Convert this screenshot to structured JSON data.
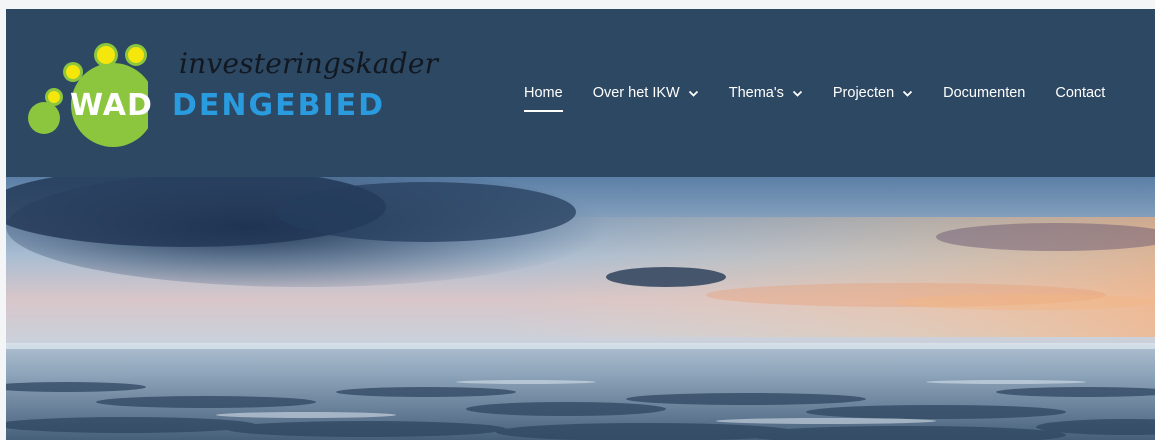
{
  "logo": {
    "line1": "investeringskader",
    "wad": "WAD",
    "rest": "DENGEBIED",
    "colors": {
      "green": "#8cc63f",
      "yellow": "#f5e60c",
      "blue": "#2b9be0"
    }
  },
  "nav": {
    "items": [
      {
        "label": "Home",
        "active": true,
        "has_dropdown": false
      },
      {
        "label": "Over het IKW",
        "active": false,
        "has_dropdown": true
      },
      {
        "label": "Thema's",
        "active": false,
        "has_dropdown": true
      },
      {
        "label": "Projecten",
        "active": false,
        "has_dropdown": true
      },
      {
        "label": "Documenten",
        "active": false,
        "has_dropdown": false
      },
      {
        "label": "Contact",
        "active": false,
        "has_dropdown": false
      }
    ]
  },
  "theme": {
    "header_bg": "#2d4862",
    "nav_text": "#ffffff"
  },
  "hero": {
    "icon": "wadden-sea-sunset-photo"
  }
}
